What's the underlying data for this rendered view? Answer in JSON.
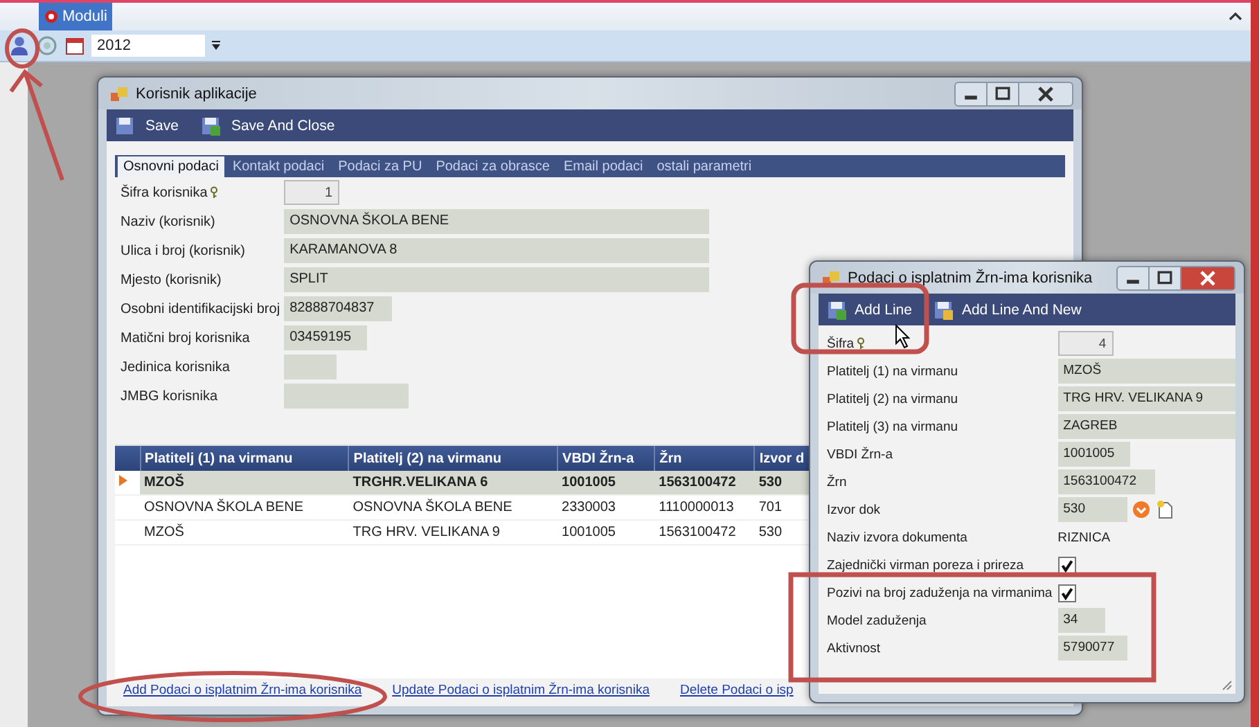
{
  "app": {
    "module_tab": "Moduli",
    "year": "2012"
  },
  "main_window": {
    "title": "Korisnik aplikacije",
    "toolbar": [
      {
        "label": "Save",
        "kind": "save"
      },
      {
        "label": "Save And Close",
        "kind": "save_close"
      }
    ],
    "tabs": [
      {
        "label": "Osnovni podaci",
        "selected": true
      },
      {
        "label": "Kontakt podaci",
        "selected": false
      },
      {
        "label": "Podaci za PU",
        "selected": false
      },
      {
        "label": "Podaci za obrasce",
        "selected": false
      },
      {
        "label": "Email podaci",
        "selected": false
      },
      {
        "label": "ostali parametri",
        "selected": false
      }
    ],
    "fields": [
      {
        "label": "Šifra korisnika",
        "value": "1",
        "kind": "key"
      },
      {
        "label": "Naziv (korisnik)",
        "value": "OSNOVNA ŠKOLA BENE",
        "kind": "text"
      },
      {
        "label": "Ulica i broj (korisnik)",
        "value": "KARAMANOVA 8",
        "kind": "text"
      },
      {
        "label": "Mjesto (korisnik)",
        "value": "SPLIT",
        "kind": "text"
      },
      {
        "label": "Osobni identifikacijski broj",
        "value": "82888704837",
        "kind": "text"
      },
      {
        "label": "Matični broj korisnika",
        "value": "03459195",
        "kind": "text"
      },
      {
        "label": "Jedinica korisnika",
        "kind": "text"
      },
      {
        "label": "JMBG korisnika",
        "kind": "text"
      }
    ],
    "table": {
      "columns": [
        "Platitelj (1) na virmanu",
        "Platitelj (2) na virmanu",
        "VBDI Žrn-a",
        "Žrn",
        "Izvor d"
      ],
      "rows": [
        {
          "cells": [
            "MZOŠ",
            "TRGHR.VELIKANA 6",
            "1001005",
            "1563100472",
            "530"
          ],
          "selected": true
        },
        {
          "cells": [
            "OSNOVNA ŠKOLA BENE",
            "OSNOVNA ŠKOLA BENE",
            "2330003",
            "1110000013",
            "701"
          ],
          "selected": false
        },
        {
          "cells": [
            "MZOŠ",
            "TRG HRV. VELIKANA 9",
            "1001005",
            "1563100472",
            "530"
          ],
          "selected": false
        }
      ]
    },
    "links": [
      "Add Podaci o isplatnim Žrn-ima korisnika",
      "Update Podaci o isplatnim Žrn-ima korisnika",
      "Delete Podaci o isp"
    ]
  },
  "detail_window": {
    "title": "Podaci o isplatnim Žrn-ima korisnika",
    "toolbar": [
      {
        "label": "Add Line",
        "kind": "add"
      },
      {
        "label": "Add Line And New",
        "kind": "add_new"
      }
    ],
    "fields": [
      {
        "label": "Šifra",
        "value": "4",
        "kind": "key"
      },
      {
        "label": "Platitelj (1) na virmanu",
        "value": "MZOŠ",
        "kind": "text"
      },
      {
        "label": "Platitelj (2) na virmanu",
        "value": "TRG HRV. VELIKANA 9",
        "kind": "text"
      },
      {
        "label": "Platitelj (3) na virmanu",
        "value": "ZAGREB",
        "kind": "text"
      },
      {
        "label": "VBDI Žrn-a",
        "value": "1001005",
        "kind": "text"
      },
      {
        "label": "Žrn",
        "value": "1563100472",
        "kind": "text"
      },
      {
        "label": "Izvor dok",
        "value": "530",
        "kind": "lookup"
      },
      {
        "label": "Naziv izvora dokumenta",
        "value": "RIZNICA",
        "kind": "plain"
      },
      {
        "label": "Zajednički virman poreza i prireza",
        "checked": true,
        "kind": "check"
      },
      {
        "label": "Pozivi na broj zaduženja na virmanima",
        "checked": true,
        "kind": "check"
      },
      {
        "label": "Model zaduženja",
        "value": "34",
        "kind": "text"
      },
      {
        "label": "Aktivnost",
        "value": "5790077",
        "kind": "text"
      }
    ]
  }
}
